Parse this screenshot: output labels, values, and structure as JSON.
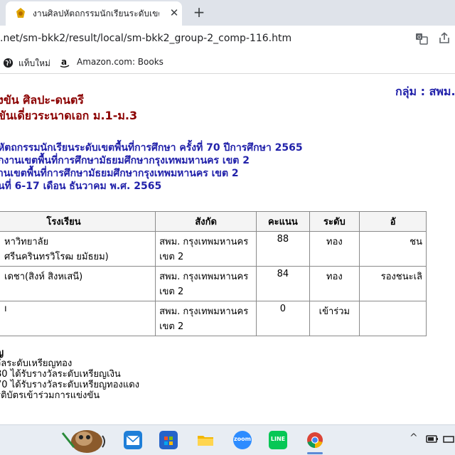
{
  "browser": {
    "tab_title": "งานศิลปหัตถกรรมนักเรียนระดับเขตพื้นที่",
    "close_glyph": "✕",
    "new_tab_glyph": "+",
    "url": ".net/sm-bkk2/result/local/sm-bkk2_group-2_comp-116.htm",
    "bookmarks": [
      {
        "label": "แท็บใหม่"
      },
      {
        "label": "Amazon.com: Books"
      }
    ]
  },
  "page": {
    "title_line1": "่งขัน ศิลปะ-ดนตรี",
    "title_line2": "ขันเดี่ยวระนาดเอก ม.1-ม.3",
    "group_label": "กลุ่ม : สพม.",
    "info": [
      "หัตถกรรมนักเรียนระดับเขตพื้นที่การศึกษา ครั้งที่ 70 ปีการศึกษา 2565",
      "ักงานเขตพื้นที่การศึกษามัธยมศึกษากรุงเทพมหานคร เขต 2",
      "านเขตพื้นที่การศึกษามัธยมศึกษากรุงเทพมหานคร เขต 2",
      "นที่ 6-17 เดือน ธันวาคม พ.ศ. 2565"
    ]
  },
  "table": {
    "headers": [
      "โรงเรียน",
      "สังกัด",
      "คะแนน",
      "ระดับ",
      "อั"
    ],
    "rows": [
      {
        "school": "หาวิทยาลัยศรีนครินทรวิโรฒ ยมัธยม)",
        "affiliation": "สพม. กรุงเทพมหานคร เขต 2",
        "score": "88",
        "level": "ทอง",
        "award": "ชน"
      },
      {
        "school": "เดชา(สิงห์ สิงหเสนี)",
        "affiliation": "สพม. กรุงเทพมหานคร เขต 2",
        "score": "84",
        "level": "ทอง",
        "award": "รองชนะเลิ"
      },
      {
        "school": "ı",
        "affiliation": "สพม. กรุงเทพมหานคร เขต 2",
        "score": "0",
        "level": "เข้าร่วม",
        "award": ""
      }
    ]
  },
  "legend": {
    "heading": "ญ",
    "lines": [
      "วัลระดับเหรียญทอง",
      "80   ได้รับรางวัลระดับเหรียญเงิน",
      "70   ได้รับรางวัลระดับเหรียญทองแดง",
      "รติบัตรเข้าร่วมการแข่งขัน"
    ]
  },
  "taskbar": {
    "apps": [
      {
        "icon": "mail-icon",
        "color": "#1f7fd8"
      },
      {
        "icon": "store-icon",
        "color": "#2563c9"
      },
      {
        "icon": "folder-icon",
        "color": "#f2b705"
      },
      {
        "icon": "zoom-icon",
        "color": "#2d8cff",
        "label": "zoom"
      },
      {
        "icon": "line-icon",
        "color": "#06c755",
        "label": "LINE"
      },
      {
        "icon": "chrome-icon",
        "color": "#db4437"
      }
    ],
    "tray_caret": "^"
  }
}
